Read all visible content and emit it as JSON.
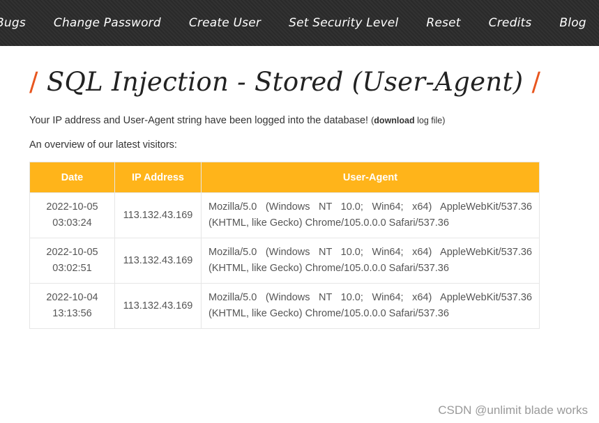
{
  "nav": {
    "items": [
      {
        "label": "Bugs"
      },
      {
        "label": "Change Password"
      },
      {
        "label": "Create User"
      },
      {
        "label": "Set Security Level"
      },
      {
        "label": "Reset"
      },
      {
        "label": "Credits"
      },
      {
        "label": "Blog"
      }
    ]
  },
  "header": {
    "slash": "/",
    "title": "SQL Injection - Stored (User-Agent)"
  },
  "intro": {
    "text": "Your IP address and User-Agent string have been logged into the database! ",
    "open_paren": "(",
    "download_label": "download",
    "log_file": " log file)"
  },
  "overview": "An overview of our latest visitors:",
  "table": {
    "headers": [
      "Date",
      "IP Address",
      "User-Agent"
    ],
    "rows": [
      {
        "date": "2022-10-05",
        "time": "03:03:24",
        "ip": "113.132.43.169",
        "ua": "Mozilla/5.0 (Windows NT 10.0; Win64; x64) AppleWebKit/537.36 (KHTML, like Gecko) Chrome/105.0.0.0 Safari/537.36"
      },
      {
        "date": "2022-10-05",
        "time": "03:02:51",
        "ip": "113.132.43.169",
        "ua": "Mozilla/5.0 (Windows NT 10.0; Win64; x64) AppleWebKit/537.36 (KHTML, like Gecko) Chrome/105.0.0.0 Safari/537.36"
      },
      {
        "date": "2022-10-04",
        "time": "13:13:56",
        "ip": "113.132.43.169",
        "ua": "Mozilla/5.0 (Windows NT 10.0; Win64; x64) AppleWebKit/537.36 (KHTML, like Gecko) Chrome/105.0.0.0 Safari/537.36"
      }
    ]
  },
  "watermark": "CSDN @unlimit blade works",
  "colors": {
    "menubar": "#2b2b2b",
    "accent_slash": "#e8561f",
    "table_header": "#ffb41a"
  }
}
